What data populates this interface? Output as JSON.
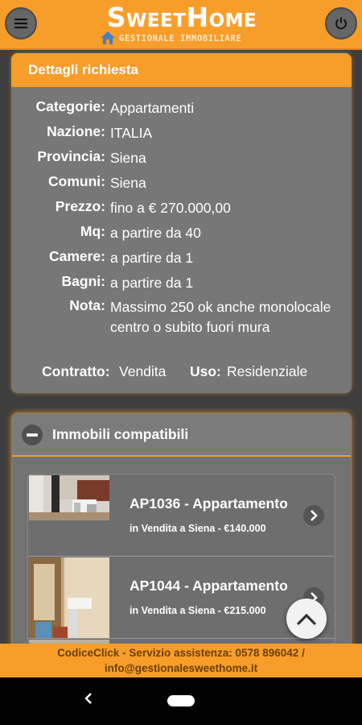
{
  "app": {
    "logo_title": "SweetHome",
    "logo_subtitle": "Gestionale Immobiliare",
    "menu_icon": "hamburger-menu-icon",
    "power_icon": "power-icon",
    "colors": {
      "accent": "#f79d2a",
      "panel": "#777777",
      "background": "#3e3e3e"
    }
  },
  "details": {
    "title": "Dettagli richiesta",
    "rows": [
      {
        "label": "Categorie:",
        "value": "Appartamenti"
      },
      {
        "label": "Nazione:",
        "value": "ITALIA"
      },
      {
        "label": "Provincia:",
        "value": "Siena"
      },
      {
        "label": "Comuni:",
        "value": "Siena"
      },
      {
        "label": "Prezzo:",
        "value": "fino a € 270.000,00"
      },
      {
        "label": "Mq:",
        "value": "a partire da 40"
      },
      {
        "label": "Camere:",
        "value": "a partire da 1"
      },
      {
        "label": "Bagni:",
        "value": "a partire da 1"
      },
      {
        "label": "Nota:",
        "value": "Massimo 250 ok anche monolocale centro o subito fuori mura"
      }
    ],
    "contract_label": "Contratto:",
    "contract_value": "Vendita",
    "use_label": "Uso:",
    "use_value": "Residenziale"
  },
  "compatible": {
    "title": "Immobili compatibili",
    "items": [
      {
        "title": "AP1036 - Appartamento",
        "subtitle": "in Vendita a Siena - €140.000"
      },
      {
        "title": "AP1044 - Appartamento",
        "subtitle": "in Vendita a Siena - €215.000"
      }
    ]
  },
  "footer": {
    "line1": "CodiceClick - Servizio assistenza: 0578 896042 /",
    "line2": "info@gestionalesweethome.it"
  }
}
